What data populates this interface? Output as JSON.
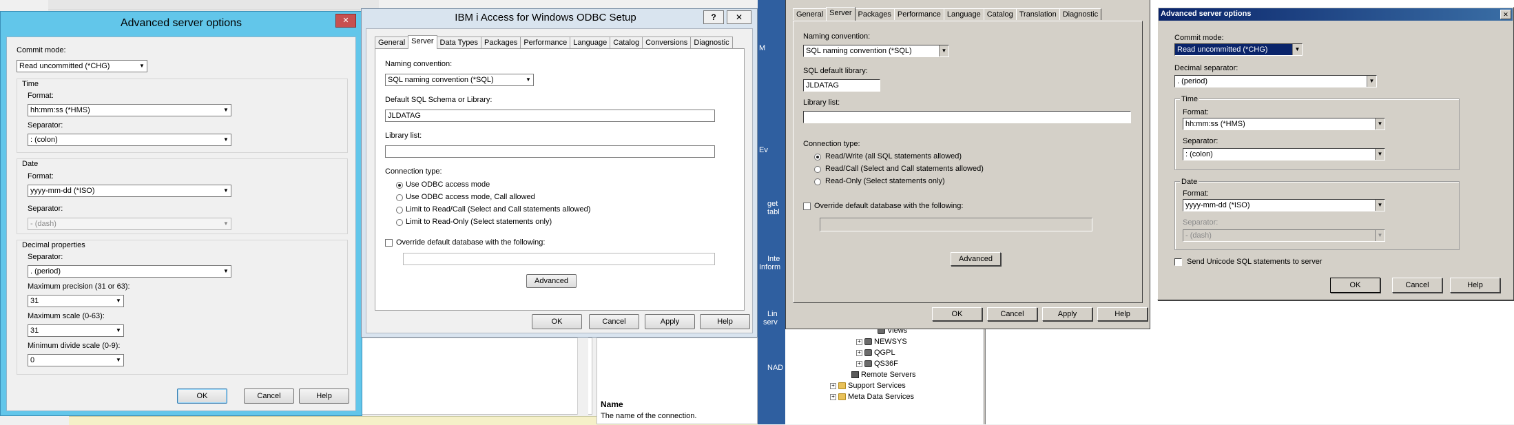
{
  "left_adv": {
    "title": "Advanced server options",
    "close_glyph": "✕",
    "commit_label": "Commit mode:",
    "commit_value": "Read uncommitted (*CHG)",
    "time_group": "Time",
    "time_format_label": "Format:",
    "time_format_value": "hh:mm:ss (*HMS)",
    "time_sep_label": "Separator:",
    "time_sep_value": ": (colon)",
    "date_group": "Date",
    "date_format_label": "Format:",
    "date_format_value": "yyyy-mm-dd (*ISO)",
    "date_sep_label": "Separator:",
    "date_sep_value": "- (dash)",
    "decimal_group": "Decimal properties",
    "dec_sep_label": "Separator:",
    "dec_sep_value": ". (period)",
    "max_prec_label": "Maximum precision (31 or 63):",
    "max_prec_value": "31",
    "max_scale_label": "Maximum scale (0-63):",
    "max_scale_value": "31",
    "min_div_label": "Minimum divide scale (0-9):",
    "min_div_value": "0",
    "ok": "OK",
    "cancel": "Cancel",
    "help": "Help"
  },
  "odbc": {
    "title": "IBM i Access for Windows ODBC Setup",
    "help_glyph": "?",
    "close_glyph": "✕",
    "tabs": [
      "General",
      "Server",
      "Data Types",
      "Packages",
      "Performance",
      "Language",
      "Catalog",
      "Conversions",
      "Diagnostic"
    ],
    "naming_label": "Naming convention:",
    "naming_value": "SQL naming convention (*SQL)",
    "schema_label": "Default SQL Schema or Library:",
    "schema_value": "JLDATAG",
    "liblist_label": "Library list:",
    "liblist_value": "",
    "conn_label": "Connection type:",
    "conn_options": [
      "Use ODBC access mode",
      "Use ODBC access mode, Call allowed",
      "Limit to Read/Call (Select and Call statements allowed)",
      "Limit to Read-Only (Select statements only)"
    ],
    "override_label": "Override default database with the following:",
    "advanced": "Advanced",
    "ok": "OK",
    "cancel": "Cancel",
    "apply": "Apply",
    "help": "Help"
  },
  "background": {
    "name_heading": "Name",
    "name_desc": "The name of the connection.",
    "side_texts": [
      "get",
      "tabl",
      "Inte",
      "Inform",
      "Lin",
      "serv",
      "NAD",
      "Ev",
      "M"
    ],
    "tree": [
      "Views",
      "NEWSYS",
      "QGPL",
      "QS36F",
      "Remote Servers",
      "Support Services",
      "Meta Data Services"
    ]
  },
  "old_odbc": {
    "tabs": [
      "General",
      "Server",
      "Packages",
      "Performance",
      "Language",
      "Catalog",
      "Translation",
      "Diagnostic"
    ],
    "naming_label": "Naming convention:",
    "naming_value": "SQL naming convention (*SQL)",
    "lib_label": "SQL default library:",
    "lib_value": "JLDATAG",
    "liblist_label": "Library list:",
    "conn_label": "Connection type:",
    "conn_options": [
      "Read/Write (all SQL statements allowed)",
      "Read/Call (Select and Call statements allowed)",
      "Read-Only (Select statements only)"
    ],
    "override_label": "Override default database with the following:",
    "advanced": "Advanced",
    "ok": "OK",
    "cancel": "Cancel",
    "apply": "Apply",
    "help": "Help"
  },
  "right_adv": {
    "title": "Advanced server options",
    "close_glyph": "✕",
    "commit_label": "Commit mode:",
    "commit_value": "Read uncommitted (*CHG)",
    "dec_sep_label": "Decimal separator:",
    "dec_sep_value": ". (period)",
    "time_group": "Time",
    "time_format_label": "Format:",
    "time_format_value": "hh:mm:ss (*HMS)",
    "time_sep_label": "Separator:",
    "time_sep_value": ": (colon)",
    "date_group": "Date",
    "date_format_label": "Format:",
    "date_format_value": "yyyy-mm-dd (*ISO)",
    "date_sep_label": "Separator:",
    "date_sep_value": "- (dash)",
    "unicode_label": "Send Unicode SQL statements to server",
    "ok": "OK",
    "cancel": "Cancel",
    "help": "Help"
  }
}
